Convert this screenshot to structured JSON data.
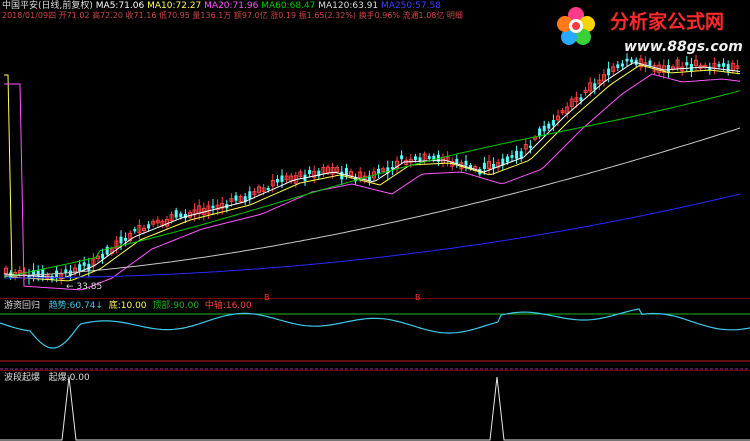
{
  "header": {
    "stock": "中国平安(日线,前复权)",
    "ma5_label": "MA5:",
    "ma5_value": "71.06",
    "ma10_label": "MA10:",
    "ma10_value": "72.27",
    "ma20_label": "MA20:",
    "ma20_value": "71.96",
    "ma60_label": "MA60:",
    "ma60_value": "68.47",
    "ma120_label": "MA120:",
    "ma120_value": "63.91",
    "ma250_label": "MA250:",
    "ma250_value": "57.58",
    "line2": "2018/01/09四 开71.02 高72.20 收71.16 低70.95 量136.1万 额97.0亿 涨0.19 振1.65(2.32%) 换手0.96% 流通1.08亿 明细"
  },
  "watermark": {
    "title": "分析家公式网",
    "url": "www.88gs.com"
  },
  "main_chart": {
    "low_marker": "33.85"
  },
  "indicator1": {
    "name": "游资回归",
    "ind_label": "趋势:",
    "ind_value": "60.74↓",
    "low_label": "底:",
    "low_value": "10.00",
    "high_label": "顶部:",
    "high_value": "90.00",
    "mid_label": "中轴:",
    "mid_value": "16.00",
    "signal_mark": "B",
    "colors": {
      "line": "#3ec8e8",
      "upper": "#22b522",
      "lower": "#c81e1e"
    }
  },
  "indicator2": {
    "name": "波段起爆",
    "label": "起爆:",
    "value": "0.00"
  },
  "colors": {
    "background": "#000000",
    "candle_up": "#ff4040",
    "candle_down": "#54ffff",
    "ma5": "#ffffff",
    "ma10": "#ffff54",
    "ma20": "#ff54ff",
    "ma60": "#00c800",
    "ma120": "#c8c8c8",
    "ma250": "#2828ff"
  }
}
